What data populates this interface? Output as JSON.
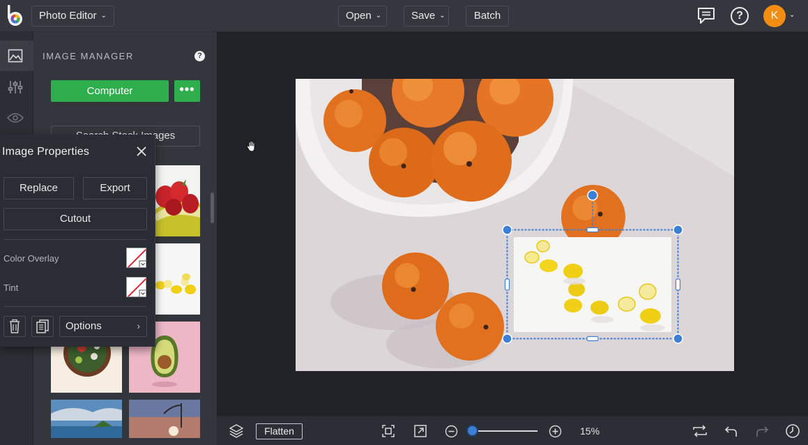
{
  "app": {
    "mode_label": "Photo Editor",
    "user_initial": "K",
    "brand_color": "#f28c13"
  },
  "topbar": {
    "open_label": "Open",
    "save_label": "Save",
    "batch_label": "Batch",
    "help_glyph": "?"
  },
  "icons": {
    "strip": [
      "image-icon",
      "sliders-icon",
      "eye-icon"
    ],
    "bottom": [
      "layers-icon",
      "fit-screen-icon",
      "expand-icon",
      "zoom-out-icon",
      "zoom-in-icon",
      "swap-icon",
      "undo-icon",
      "redo-icon",
      "history-icon"
    ]
  },
  "manager": {
    "title": "IMAGE MANAGER",
    "help_glyph": "?",
    "computer_label": "Computer",
    "more_label": "•••",
    "stock_label": "Search Stock Images"
  },
  "properties": {
    "title": "Image Properties",
    "replace_label": "Replace",
    "export_label": "Export",
    "cutout_label": "Cutout",
    "color_overlay_label": "Color Overlay",
    "tint_label": "Tint",
    "options_label": "Options",
    "options_arrow": "›"
  },
  "bottombar": {
    "flatten_label": "Flatten",
    "zoom_value": "15%",
    "zoom_fraction": 0.15
  },
  "colors": {
    "accent_green": "#2fae4e",
    "selection_blue": "#3d7fd6"
  }
}
